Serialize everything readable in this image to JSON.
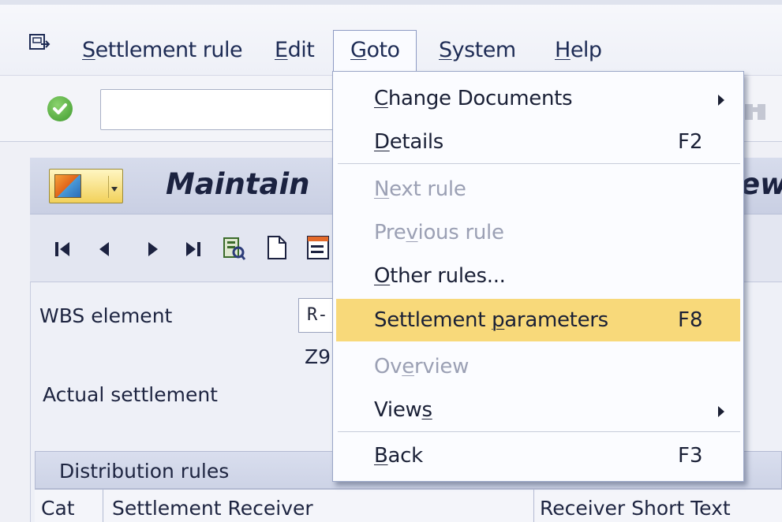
{
  "menubar": {
    "items": [
      {
        "pre": "",
        "u": "S",
        "post": "ettlement rule"
      },
      {
        "pre": "",
        "u": "E",
        "post": "dit"
      },
      {
        "pre": "",
        "u": "G",
        "post": "oto"
      },
      {
        "pre": "",
        "u": "S",
        "post": "ystem"
      },
      {
        "pre": "",
        "u": "H",
        "post": "elp"
      }
    ]
  },
  "header": {
    "title_start": "Maintain",
    "title_end": "ew"
  },
  "form": {
    "wbs_label": "WBS element",
    "wbs_value": "R-",
    "z_value": "Z9",
    "actual_settlement_label": "Actual settlement"
  },
  "table": {
    "section_title": "Distribution rules",
    "columns": [
      "Cat",
      "Settlement Receiver",
      "Receiver Short Text"
    ]
  },
  "dropdown": {
    "items": [
      {
        "pre": "",
        "u": "C",
        "post": "hange Documents",
        "key": "",
        "submenu": true,
        "enabled": true
      },
      {
        "pre": "",
        "u": "D",
        "post": "etails",
        "key": "F2",
        "submenu": false,
        "enabled": true
      },
      {
        "pre": "",
        "u": "N",
        "post": "ext rule",
        "key": "",
        "submenu": false,
        "enabled": false
      },
      {
        "pre": "Pre",
        "u": "v",
        "post": "ious rule",
        "key": "",
        "submenu": false,
        "enabled": false
      },
      {
        "pre": "",
        "u": "O",
        "post": "ther rules...",
        "key": "",
        "submenu": false,
        "enabled": true
      },
      {
        "pre": "Settlement ",
        "u": "p",
        "post": "arameters",
        "key": "F8",
        "submenu": false,
        "enabled": true,
        "highlight": true
      },
      {
        "pre": "Ov",
        "u": "e",
        "post": "rview",
        "key": "",
        "submenu": false,
        "enabled": false
      },
      {
        "pre": "View",
        "u": "s",
        "post": "",
        "key": "",
        "submenu": true,
        "enabled": true
      },
      {
        "pre": "",
        "u": "B",
        "post": "ack",
        "key": "F3",
        "submenu": false,
        "enabled": true
      }
    ]
  },
  "colors": {
    "highlight": "#f8d97a",
    "menu_text": "#1e2c55",
    "disabled_text": "#9ba0b4"
  }
}
